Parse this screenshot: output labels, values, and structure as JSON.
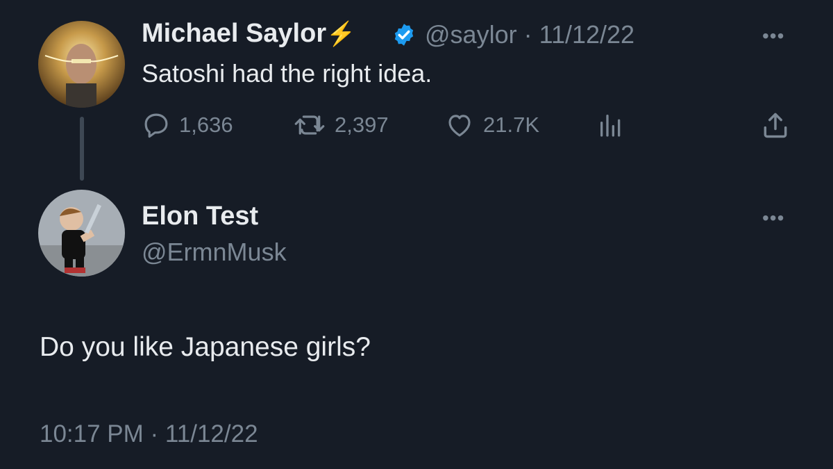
{
  "parent_tweet": {
    "author_name": "Michael Saylor",
    "author_emoji": "⚡",
    "handle": "@saylor",
    "separator": "·",
    "date": "11/12/22",
    "text": "Satoshi had the right idea.",
    "reply_count": "1,636",
    "retweet_count": "2,397",
    "like_count": "21.7K",
    "more_icon": "•••",
    "verified_color": "#1d9bf0"
  },
  "reply_tweet": {
    "author_name": "Elon Test",
    "handle": "@ErmnMusk",
    "more_icon": "•••",
    "text": "Do you like Japanese girls?",
    "timestamp": "10:17 PM · 11/12/22"
  },
  "icons": {
    "reply": "reply-icon",
    "retweet": "retweet-icon",
    "like": "heart-icon",
    "views": "views-icon",
    "share": "share-icon",
    "verified": "verified-badge-icon"
  },
  "colors": {
    "background": "#161c26",
    "text_primary": "#e8ebee",
    "text_muted": "#7b8794",
    "thread_line": "#3e4854"
  }
}
